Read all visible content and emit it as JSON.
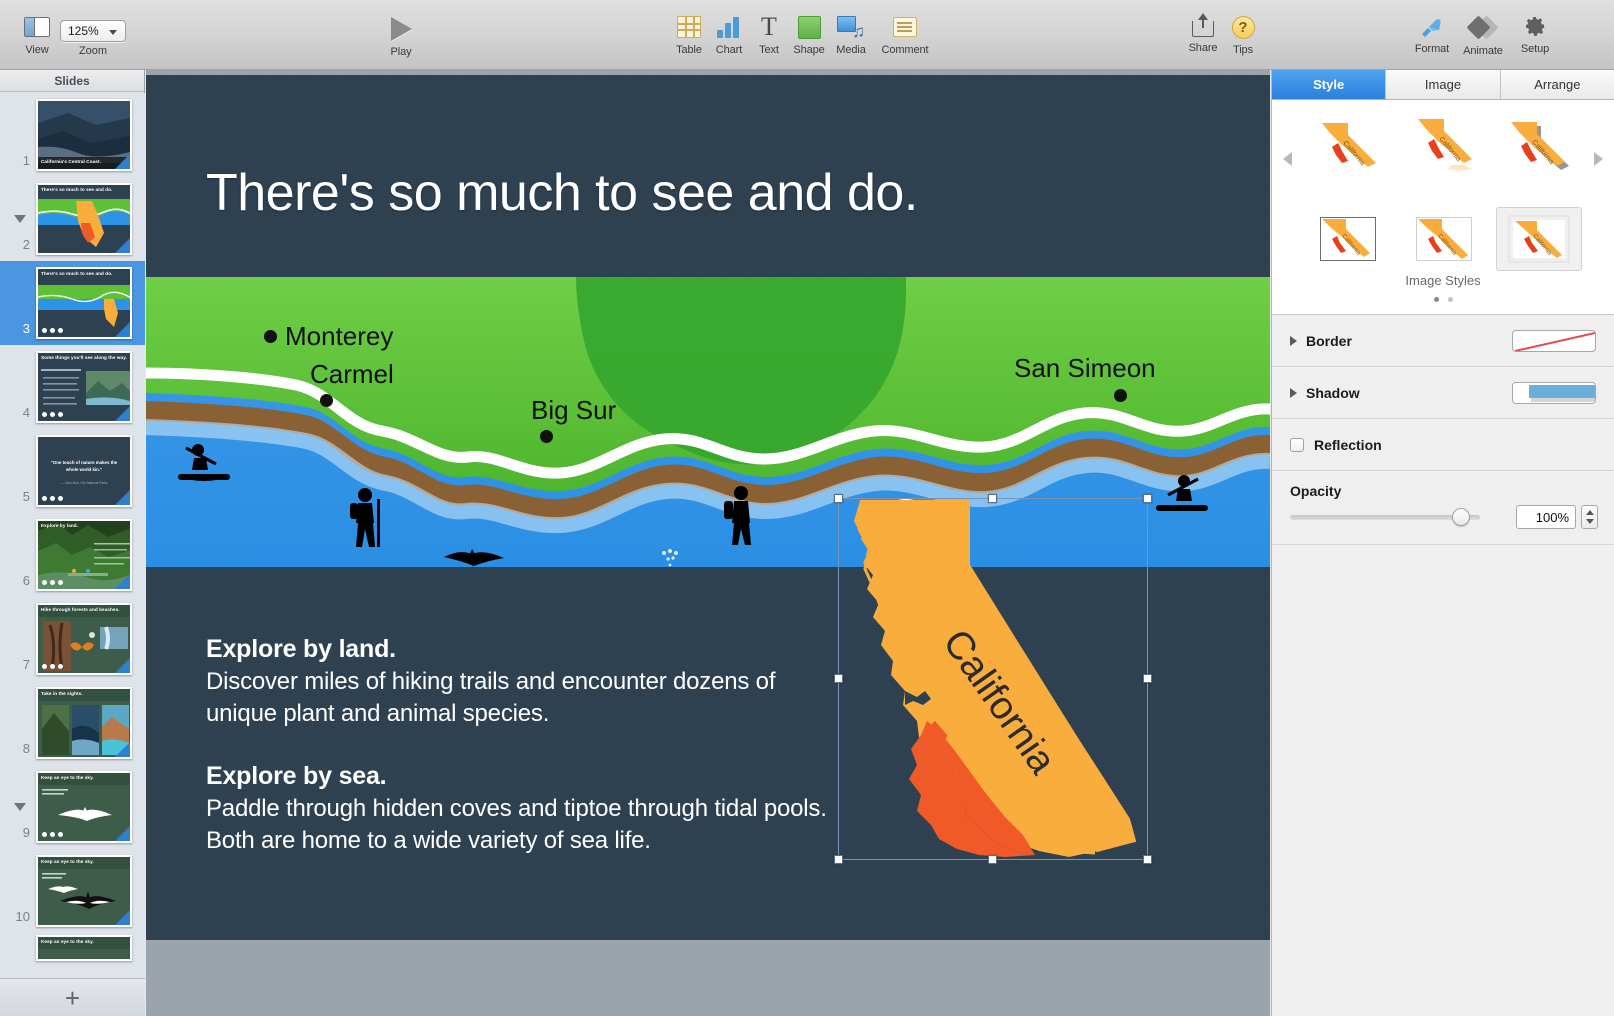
{
  "toolbar": {
    "view": {
      "label": "View",
      "icon": "view-panels-icon"
    },
    "zoom": {
      "label": "Zoom",
      "value": "125%",
      "icon": "chevron-down-icon"
    },
    "play": {
      "label": "Play",
      "icon": "play-triangle-icon"
    },
    "insert": [
      {
        "label": "Table",
        "icon": "table-icon"
      },
      {
        "label": "Chart",
        "icon": "chart-icon"
      },
      {
        "label": "Text",
        "icon": "text-icon"
      },
      {
        "label": "Shape",
        "icon": "shape-icon"
      },
      {
        "label": "Media",
        "icon": "media-icon"
      },
      {
        "label": "Comment",
        "icon": "comment-icon"
      }
    ],
    "right": [
      {
        "label": "Share",
        "icon": "share-icon"
      },
      {
        "label": "Tips",
        "icon": "question-mark-icon"
      },
      {
        "label": "Format",
        "icon": "paintbrush-icon"
      },
      {
        "label": "Animate",
        "icon": "diamonds-icon"
      },
      {
        "label": "Setup",
        "icon": "gear-icon"
      }
    ]
  },
  "navigator": {
    "header": "Slides",
    "add_button": "+",
    "selected_index": 3,
    "slides": [
      {
        "number": "1",
        "title": "California's Central Coast.",
        "kind": "photo-coast",
        "disclosure": false,
        "dots": 0
      },
      {
        "number": "2",
        "title": "There's so much to see and do.",
        "kind": "map-full",
        "disclosure": true,
        "dots": 0
      },
      {
        "number": "3",
        "title": "There's so much to see and do.",
        "kind": "map-text",
        "disclosure": false,
        "dots": 3
      },
      {
        "number": "4",
        "title": "Some things you'll see along the way.",
        "kind": "bullets-photo",
        "disclosure": false,
        "dots": 3
      },
      {
        "number": "5",
        "title": "\"One touch of nature makes the whole world kin.\"",
        "kind": "quote",
        "disclosure": false,
        "dots": 3
      },
      {
        "number": "6",
        "title": "Explore by land.",
        "kind": "forest",
        "disclosure": false,
        "dots": 3
      },
      {
        "number": "7",
        "title": "Hike through forests and beaches.",
        "kind": "collage",
        "disclosure": false,
        "dots": 3
      },
      {
        "number": "8",
        "title": "Take in the sights.",
        "kind": "three-photos",
        "disclosure": false,
        "dots": 0
      },
      {
        "number": "9",
        "title": "Keep an eye to the sky.",
        "kind": "bird-white",
        "disclosure": true,
        "dots": 3
      },
      {
        "number": "10",
        "title": "Keep an eye to the sky.",
        "kind": "bird-two",
        "disclosure": false,
        "dots": 0
      },
      {
        "number": "",
        "title": "Keep an eye to the sky.",
        "kind": "partial",
        "disclosure": false,
        "dots": 0
      }
    ]
  },
  "slide": {
    "title": "There's so much to see and do.",
    "map": {
      "route_marker": "1",
      "cities": [
        {
          "name": "Monterey"
        },
        {
          "name": "Carmel"
        },
        {
          "name": "Big Sur"
        },
        {
          "name": "San Simeon"
        }
      ],
      "state_label": "California"
    },
    "body": [
      {
        "heading": "Explore by land.",
        "text": "Discover miles of hiking trails and encounter dozens of unique plant and animal species."
      },
      {
        "heading": "Explore by sea.",
        "text": "Paddle through hidden coves and tiptoe through tidal pools. Both are home to a wide variety of sea life."
      }
    ]
  },
  "inspector": {
    "tabs": [
      {
        "label": "Style",
        "active": true
      },
      {
        "label": "Image",
        "active": false
      },
      {
        "label": "Arrange",
        "active": false
      }
    ],
    "image_styles": {
      "caption": "Image Styles",
      "page_dots": 2,
      "active_dot": 1,
      "selected_style_index": 6,
      "prev_icon": "caret-left-icon",
      "next_icon": "caret-right-icon"
    },
    "sections": [
      {
        "label": "Border",
        "type": "disclosure-swatch",
        "swatch": "no-border"
      },
      {
        "label": "Shadow",
        "type": "disclosure-swatch",
        "swatch": "shadow-preview"
      },
      {
        "label": "Reflection",
        "type": "checkbox",
        "checked": false
      }
    ],
    "opacity": {
      "label": "Opacity",
      "value": "100%",
      "percent": 100
    }
  },
  "colors": {
    "accent_blue": "#2a80dd",
    "slide_bg": "#2e4150",
    "land_green": "#5cc137",
    "land_green_dark": "#35a62e",
    "ocean_blue": "#2c93e8",
    "state_orange": "#f9ad3c",
    "region_orange": "#ef5a28",
    "cliff_brown": "#8a6134",
    "toolbar_bg": "#d4d4d4"
  }
}
